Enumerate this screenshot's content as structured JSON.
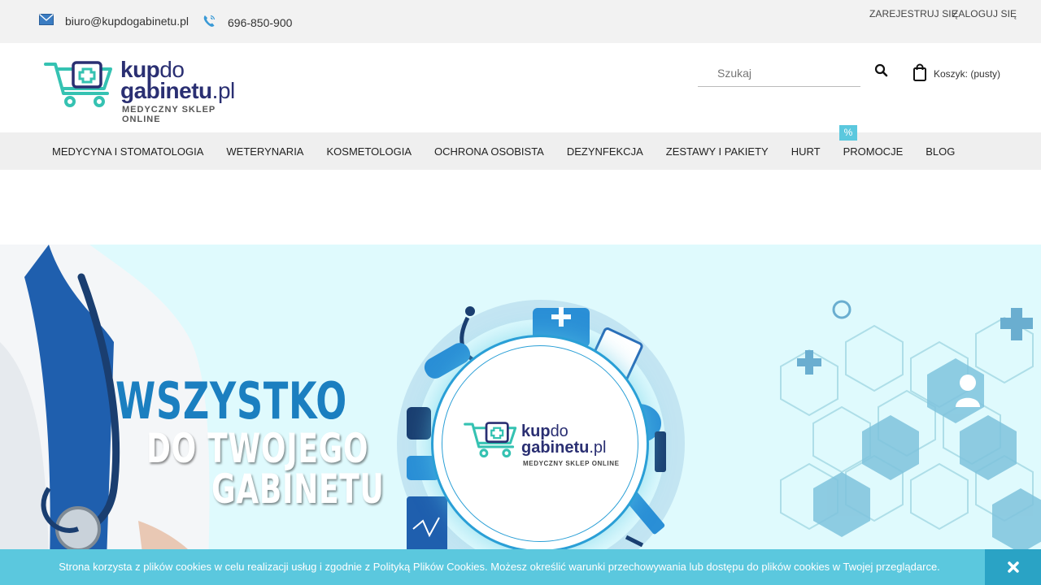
{
  "topbar": {
    "email": "biuro@kupdogabinetu.pl",
    "phone": "696-850-900",
    "register": "ZAREJESTRUJ SIĘ",
    "login": "ZALOGUJ SIĘ",
    "icons": {
      "email": "envelope-icon",
      "phone": "phone-icon"
    }
  },
  "header": {
    "logo": {
      "line1_bold": "kup",
      "line1_light": "do",
      "line2_bold": "gabinetu",
      "line2_light": ".pl",
      "tagline": "MEDYCZNY SKLEP ONLINE"
    },
    "search": {
      "placeholder": "Szukaj",
      "value": ""
    },
    "cart_label": "Koszyk: (pusty)"
  },
  "nav": {
    "items": [
      "MEDYCYNA I STOMATOLOGIA",
      "WETERYNARIA",
      "KOSMETOLOGIA",
      "OCHRONA OSOBISTA",
      "DEZYNFEKCJA",
      "ZESTAWY I PAKIETY",
      "HURT",
      "PROMOCJE",
      "BLOG"
    ],
    "promo_badge": "%"
  },
  "banner": {
    "headline1": "WSZYSTKO",
    "headline2": "DO TWOJEGO",
    "headline3": "GABINETU",
    "logo": {
      "line1_bold": "kup",
      "line1_light": "do",
      "line2_bold": "gabinetu",
      "line2_light": ".pl",
      "tagline": "MEDYCZNY SKLEP ONLINE"
    }
  },
  "cookie": {
    "text": "Strona korzysta z plików cookies w celu realizacji usług i zgodnie z Polityką Plików Cookies. Możesz określić warunki przechowywania lub dostępu do plików cookies w Twojej przeglądarce."
  },
  "colors": {
    "brand_navy": "#2a2f72",
    "accent_teal": "#5bc8de",
    "banner_bg": "#dffafd",
    "headline_blue": "#1b7fc0"
  }
}
